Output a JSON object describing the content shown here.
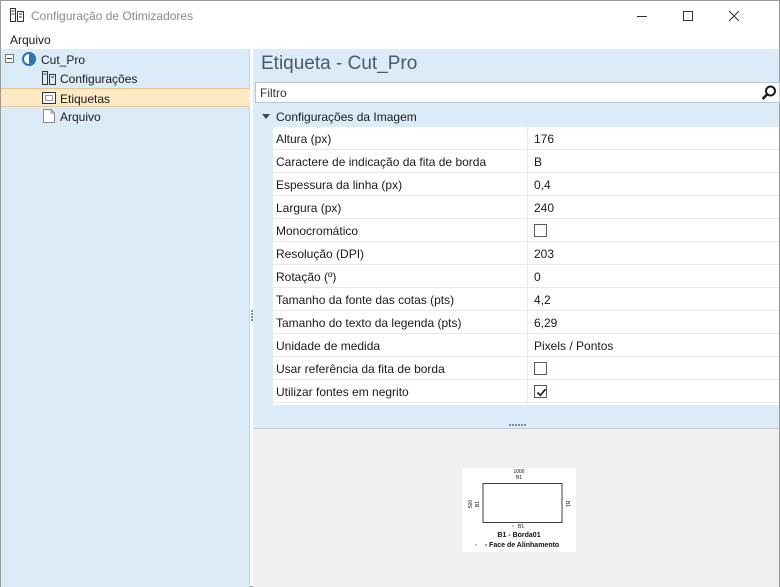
{
  "window": {
    "title": "Configuração de Otimizadores",
    "icon": "app-icon"
  },
  "menu": {
    "items": [
      "Arquivo"
    ]
  },
  "tree": {
    "root": {
      "label": "Cut_Pro",
      "icon": "globe-icon",
      "expanded": true
    },
    "children": [
      {
        "label": "Configurações",
        "icon": "settings-icon",
        "selected": false
      },
      {
        "label": "Etiquetas",
        "icon": "label-icon",
        "selected": true
      },
      {
        "label": "Arquivo",
        "icon": "file-icon",
        "selected": false
      }
    ]
  },
  "main": {
    "heading": "Etiqueta - Cut_Pro",
    "filter_placeholder": "Filtro",
    "category": "Configurações da Imagem",
    "properties": [
      {
        "name": "Altura (px)",
        "value": "176"
      },
      {
        "name": "Caractere de indicação da fita de borda",
        "value": "B"
      },
      {
        "name": "Espessura da linha (px)",
        "value": "0,4"
      },
      {
        "name": "Largura (px)",
        "value": "240"
      },
      {
        "name": "Monocromático",
        "checked": false
      },
      {
        "name": "Resolução (DPI)",
        "value": "203"
      },
      {
        "name": "Rotação (º)",
        "value": "0"
      },
      {
        "name": "Tamanho da fonte das cotas (pts)",
        "value": "4,2"
      },
      {
        "name": "Tamanho do texto da legenda (pts)",
        "value": "6,29"
      },
      {
        "name": "Unidade de medida",
        "value": "Pixels / Pontos"
      },
      {
        "name": "Usar referência da fita de borda",
        "checked": false
      },
      {
        "name": "Utilizar fontes em negrito",
        "checked": true
      }
    ]
  },
  "preview": {
    "top_dim": "1000",
    "top_edge": "B1",
    "left_dim": "500",
    "left_edge": "B1",
    "right_edge": "B1",
    "bottom_edge": "B1",
    "legend_line1": "B1 - Borda01",
    "legend_line2": "- Face de Alinhamento"
  },
  "colors": {
    "panel": "#dcebf8",
    "selected": "#fde9c4",
    "accent_text": "#4a5a6a"
  }
}
